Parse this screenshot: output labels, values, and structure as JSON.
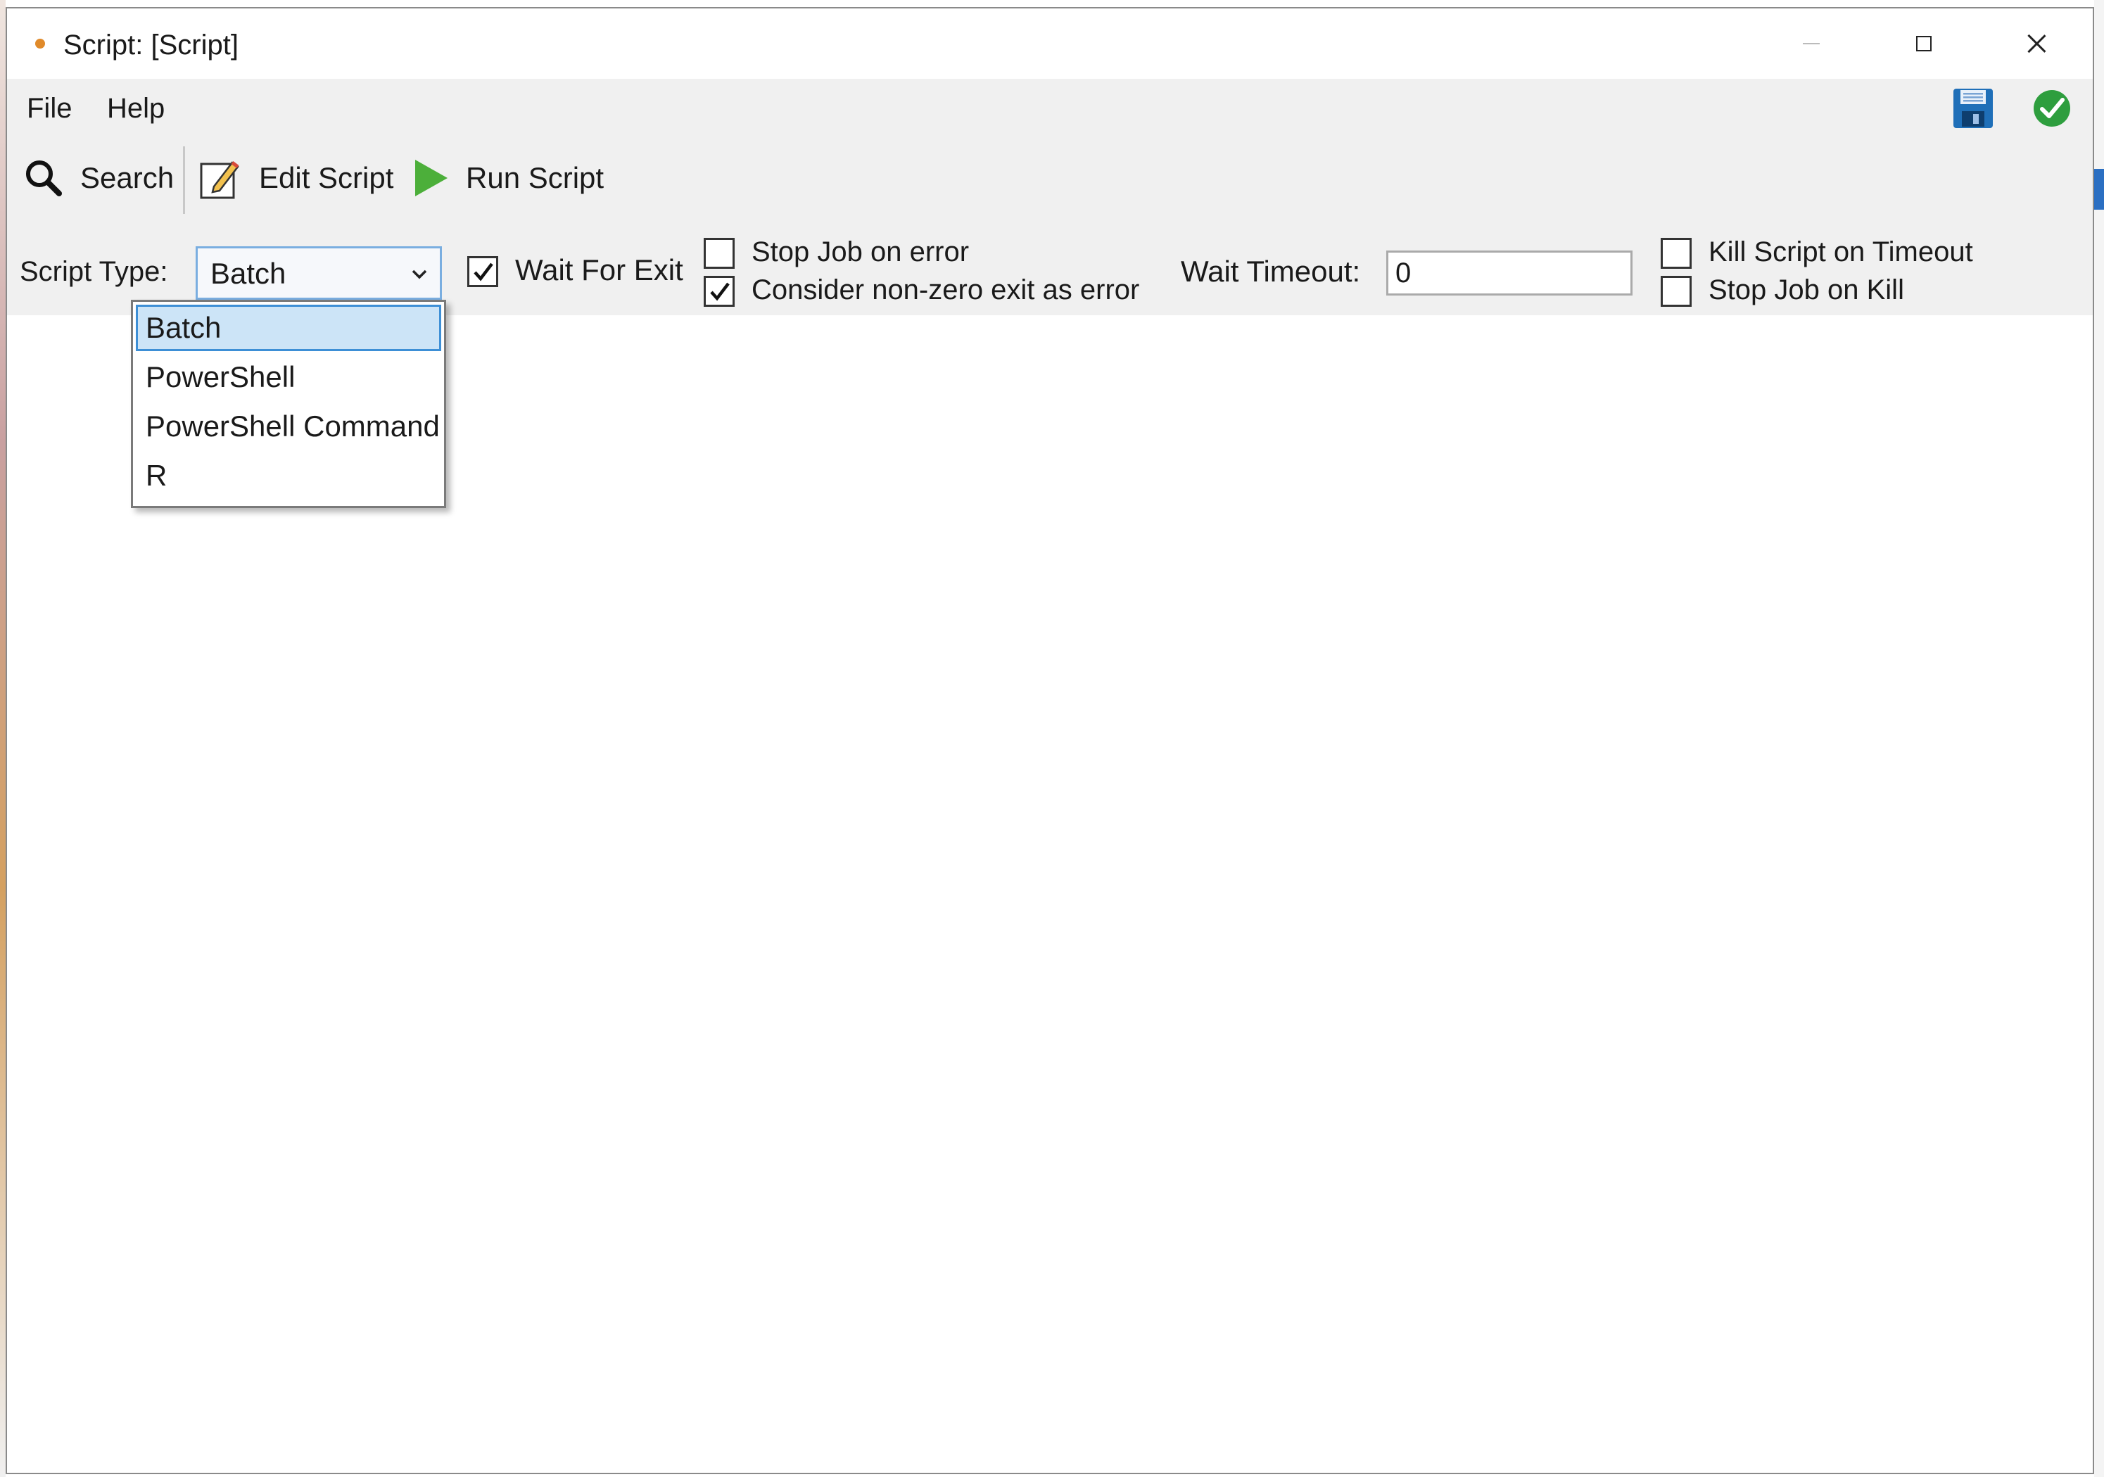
{
  "window": {
    "title": "Script: [Script]",
    "controls": {
      "minimize": "minimize",
      "maximize": "maximize",
      "close": "close"
    }
  },
  "menu": {
    "file": "File",
    "help": "Help"
  },
  "toolbar": {
    "search_label": "Search",
    "edit_label": "Edit Script",
    "run_label": "Run Script",
    "icons": {
      "search": "search-icon",
      "edit": "edit-script-icon",
      "run": "play-icon",
      "save": "save-icon",
      "validate": "checkmark-icon"
    }
  },
  "options": {
    "script_type_label": "Script Type:",
    "script_type_value": "Batch",
    "script_type_options": [
      "Batch",
      "PowerShell",
      "PowerShell Command",
      "R"
    ],
    "wait_for_exit": {
      "label": "Wait For Exit",
      "checked": true
    },
    "stop_job_on_error": {
      "label": "Stop Job on error",
      "checked": false
    },
    "consider_nonzero": {
      "label": "Consider non-zero exit as error",
      "checked": true
    },
    "wait_timeout_label": "Wait Timeout:",
    "wait_timeout_value": "0",
    "kill_on_timeout": {
      "label": "Kill Script on Timeout",
      "checked": false
    },
    "stop_job_on_kill": {
      "label": "Stop Job on Kill",
      "checked": false
    }
  },
  "colors": {
    "chrome_bg": "#f0f0f0",
    "accent_blue": "#3d8fd6",
    "selected_bg": "#cce4f7",
    "run_green": "#4caf3a",
    "save_blue": "#1f6fb8",
    "check_green": "#2e9e3e"
  }
}
